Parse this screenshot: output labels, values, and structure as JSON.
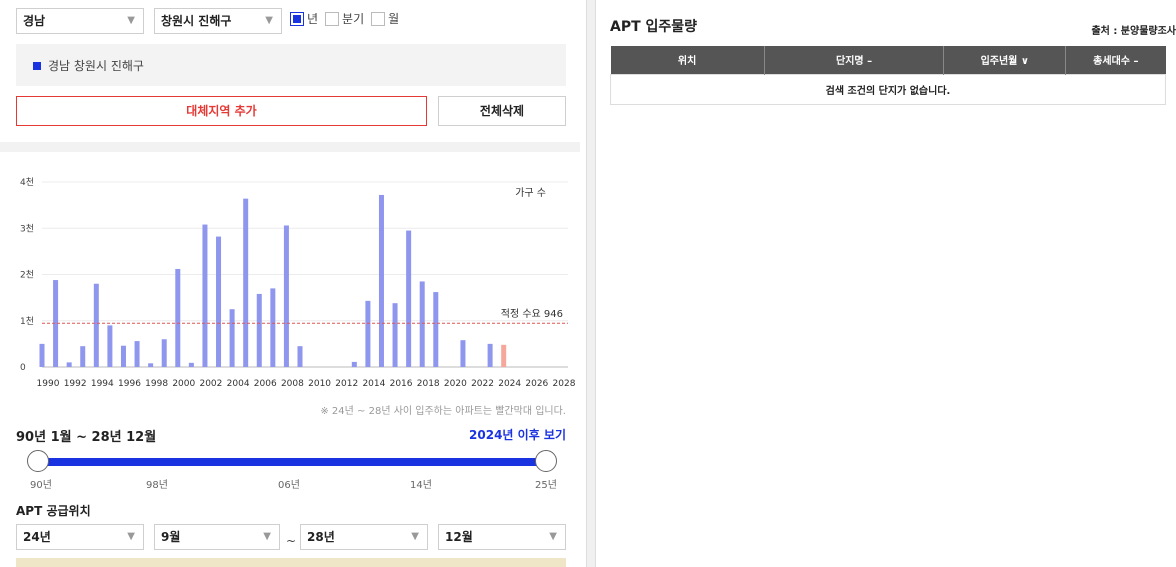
{
  "filters": {
    "province": "경남",
    "city": "창원시 진해구",
    "period_options": [
      {
        "label": "년",
        "checked": true
      },
      {
        "label": "분기",
        "checked": false
      },
      {
        "label": "월",
        "checked": false
      }
    ]
  },
  "selected_region": "경남 창원시 진해구",
  "buttons": {
    "add_region": "대체지역 추가",
    "delete_all": "전체삭제"
  },
  "chart_data": {
    "type": "bar",
    "categories": [
      "1990",
      "1991",
      "1992",
      "1993",
      "1994",
      "1995",
      "1996",
      "1997",
      "1998",
      "1999",
      "2000",
      "2001",
      "2002",
      "2003",
      "2004",
      "2005",
      "2006",
      "2007",
      "2008",
      "2009",
      "2010",
      "2011",
      "2012",
      "2013",
      "2014",
      "2015",
      "2016",
      "2017",
      "2018",
      "2019",
      "2020",
      "2021",
      "2022",
      "2023",
      "2024",
      "2025",
      "2026",
      "2027",
      "2028"
    ],
    "values": [
      500,
      1880,
      100,
      450,
      1800,
      900,
      460,
      560,
      80,
      600,
      2120,
      90,
      3080,
      2820,
      1250,
      3640,
      1580,
      1700,
      3060,
      450,
      0,
      0,
      0,
      110,
      1430,
      3720,
      1380,
      2950,
      1850,
      1620,
      0,
      580,
      0,
      500,
      480,
      0,
      0,
      0,
      0
    ],
    "highlight_from": "2024",
    "x_tick_labels": [
      "1990",
      "1992",
      "1994",
      "1996",
      "1998",
      "2000",
      "2002",
      "2004",
      "2006",
      "2008",
      "2010",
      "2012",
      "2014",
      "2016",
      "2018",
      "2020",
      "2022",
      "2024",
      "2026",
      "2028"
    ],
    "y_tick_labels": [
      "0",
      "1천",
      "2천",
      "3천",
      "4천"
    ],
    "ylim": [
      0,
      4000
    ],
    "legend": "가구 수",
    "reference_line": {
      "label": "적정 수요 946",
      "value": 946
    },
    "bar_color": "#8f96ee",
    "highlight_color": "#f6a79c",
    "grid": true
  },
  "chart_note": "※ 24년 ~ 28년 사이 입주하는 아파트는 빨간막대 입니다.",
  "range": {
    "title": "90년 1월 ~ 28년 12월",
    "link": "2024년 이후 보기",
    "slider_labels": [
      "90년",
      "98년",
      "06년",
      "14년",
      "25년"
    ],
    "start_fraction": 0,
    "end_fraction": 1
  },
  "supply": {
    "title": "APT 공급위치",
    "from_year": "24년",
    "from_month": "9월",
    "tilde": "~",
    "to_year": "28년",
    "to_month": "12월"
  },
  "apt": {
    "title": "APT 입주물량",
    "source": "출처 : 분양물량조사",
    "columns": [
      "위치",
      "단지명 –",
      "입주년월 ∨",
      "총세대수 –"
    ],
    "empty_message": "검색 조건의 단지가 없습니다."
  },
  "colors": {
    "accent": "#1a33e0",
    "danger": "#e53935",
    "header_bg": "#555555"
  }
}
